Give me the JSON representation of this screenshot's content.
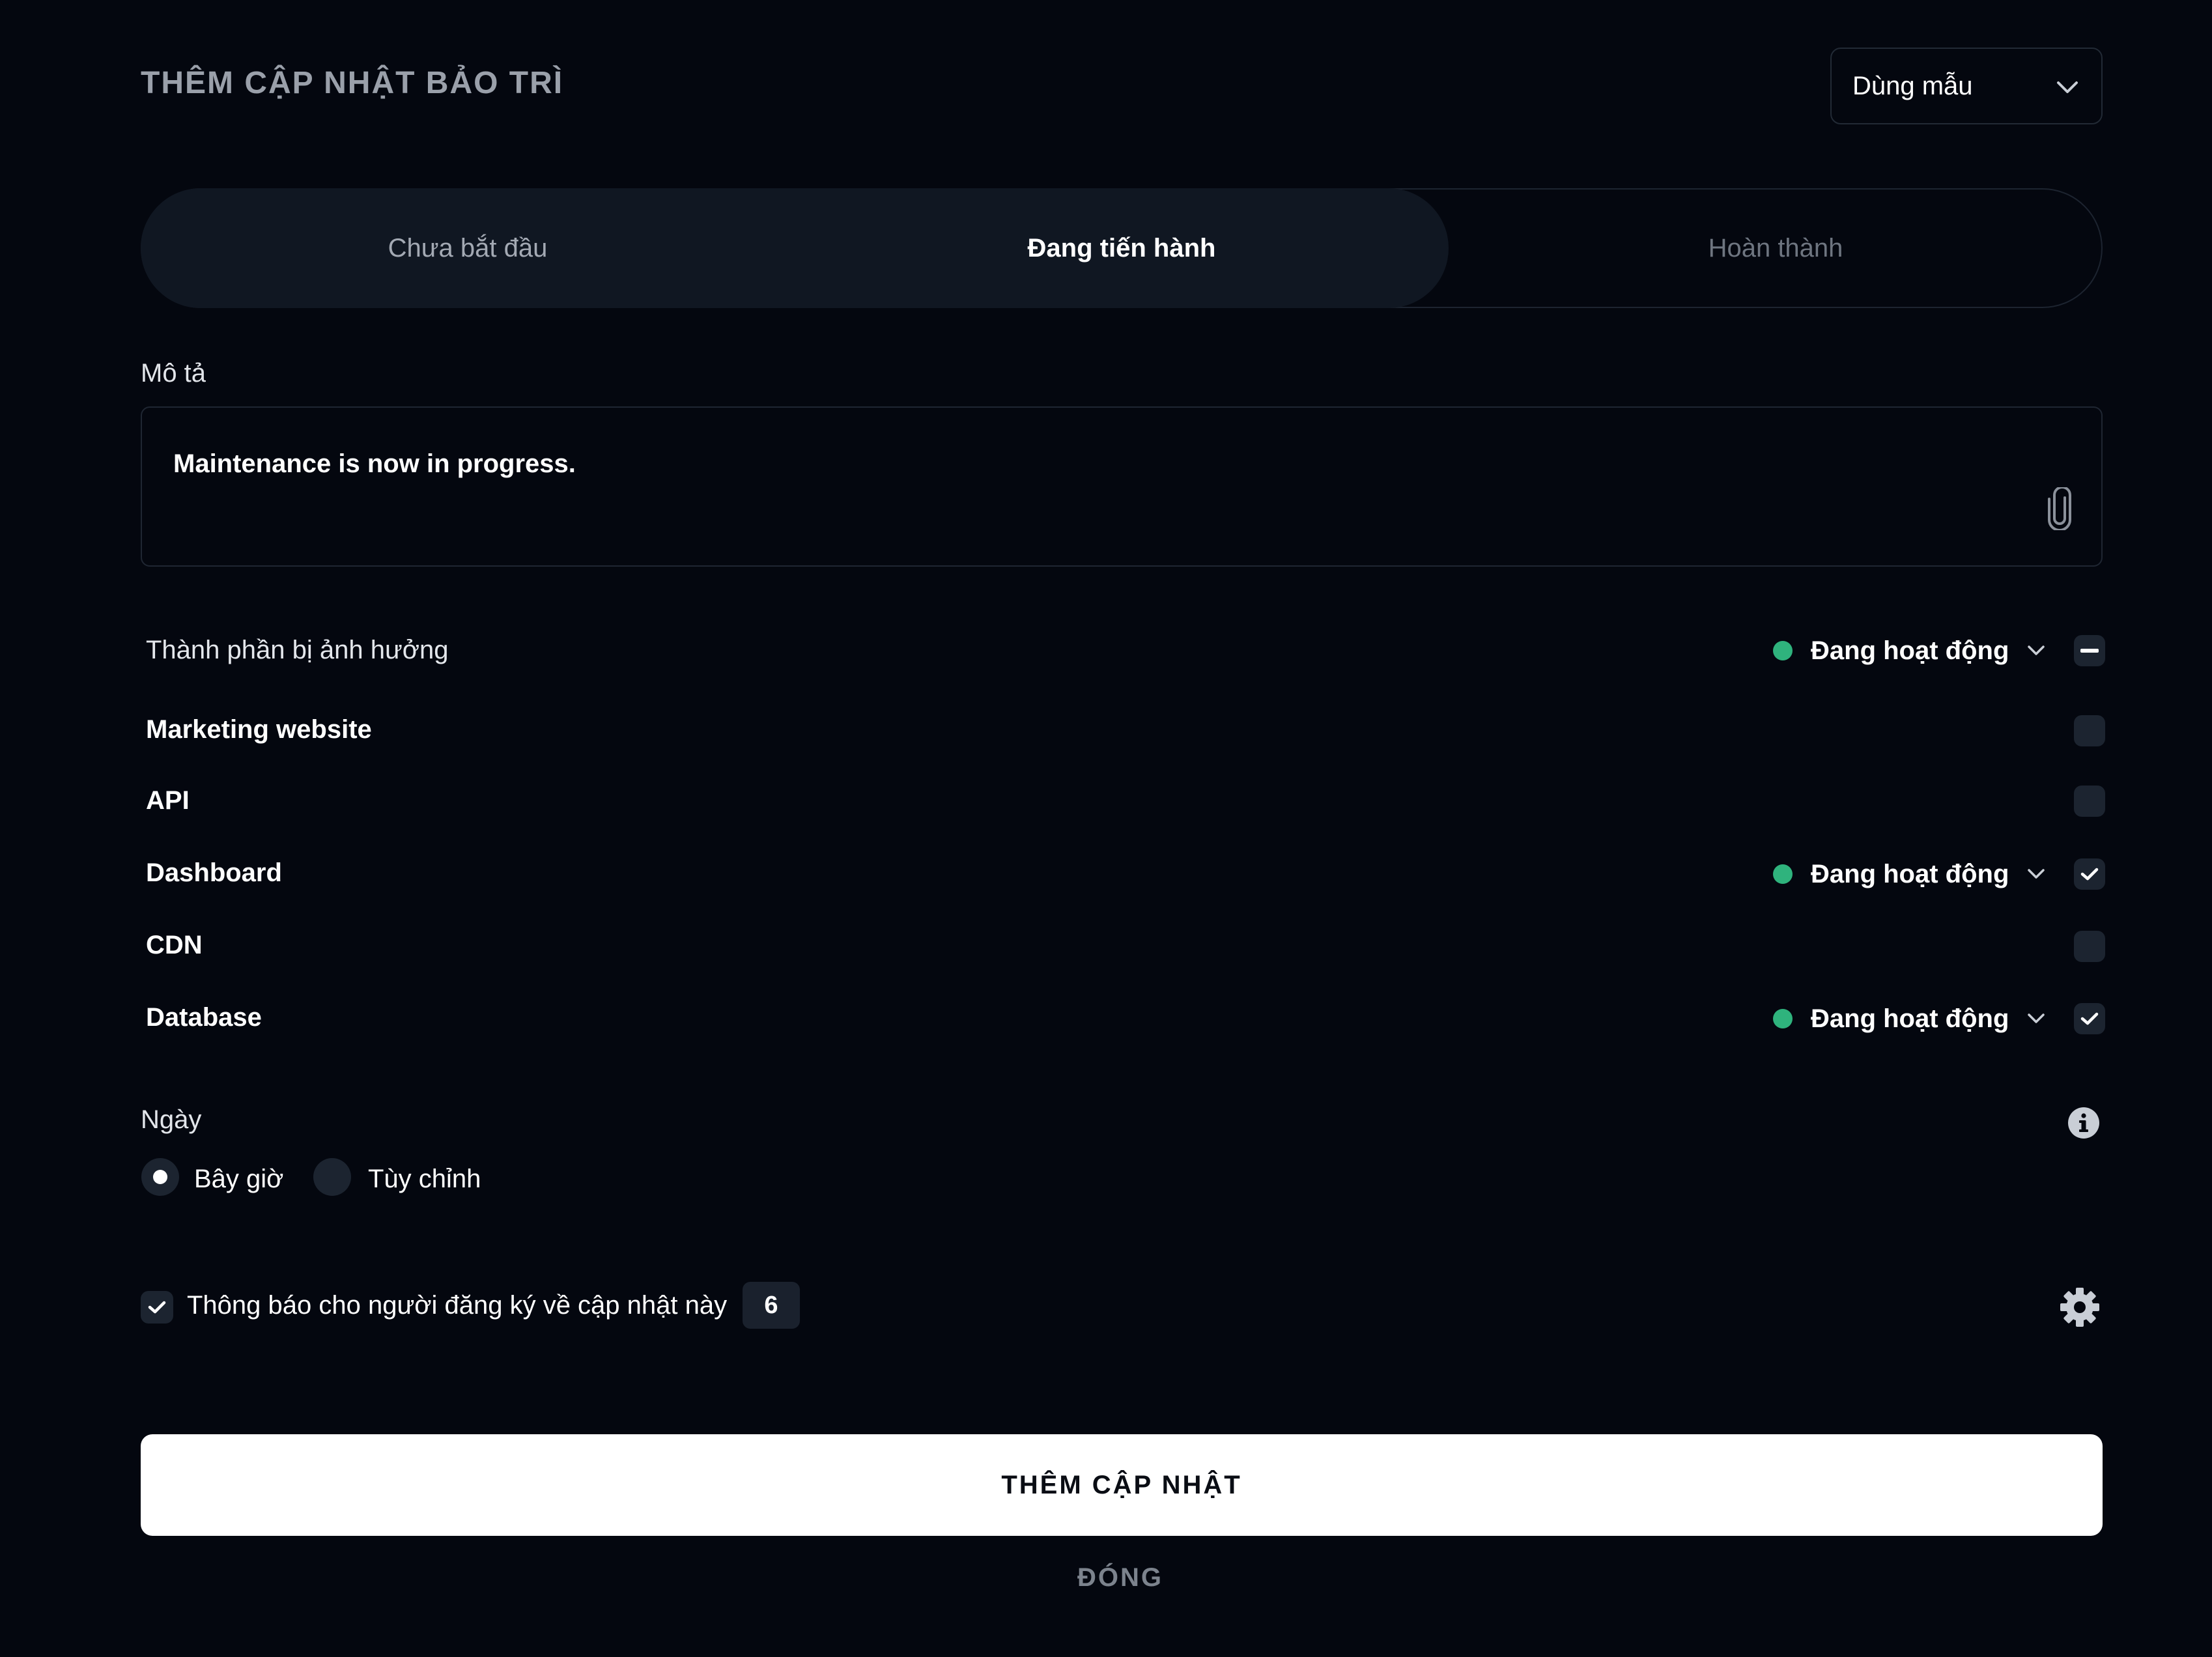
{
  "header": {
    "title": "THÊM CẬP NHẬT BẢO TRÌ",
    "template_select": {
      "value": "Dùng mẫu",
      "icon": "chevron-down-icon"
    }
  },
  "status_tabs": [
    {
      "label": "Chưa bắt đầu",
      "selected": false
    },
    {
      "label": "Đang tiến hành",
      "selected": true
    },
    {
      "label": "Hoàn thành",
      "selected": false
    }
  ],
  "description": {
    "label": "Mô tả",
    "value": "Maintenance is now in progress.",
    "attach_icon": "paperclip-icon"
  },
  "components": {
    "header_label": "Thành phần bị ảnh hưởng",
    "header_status": "Đang hoạt động",
    "header_checkbox_state": "indeterminate",
    "status_color": "#2fb37d",
    "items": [
      {
        "name": "Marketing website",
        "checked": false,
        "status": null
      },
      {
        "name": "API",
        "checked": false,
        "status": null
      },
      {
        "name": "Dashboard",
        "checked": true,
        "status": "Đang hoạt động"
      },
      {
        "name": "CDN",
        "checked": false,
        "status": null
      },
      {
        "name": "Database",
        "checked": true,
        "status": "Đang hoạt động"
      }
    ]
  },
  "date": {
    "label": "Ngày",
    "info_icon": "info-icon",
    "options": [
      {
        "label": "Bây giờ",
        "selected": true
      },
      {
        "label": "Tùy chỉnh",
        "selected": false
      }
    ]
  },
  "notify": {
    "checked": true,
    "label": "Thông báo cho người đăng ký về cập nhật này",
    "count": "6",
    "settings_icon": "gear-icon"
  },
  "actions": {
    "primary_label": "THÊM CẬP NHẬT",
    "close_label": "ĐÓNG"
  }
}
